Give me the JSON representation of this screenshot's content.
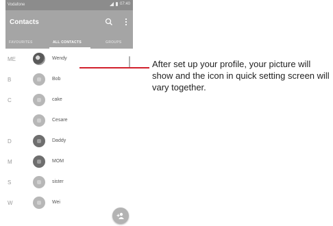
{
  "status_bar": {
    "carrier": "Vodafone",
    "time": "07:40"
  },
  "app_bar": {
    "title": "Contacts",
    "search_icon": "search-icon",
    "more_icon": "more-vert-icon",
    "tabs": [
      {
        "label": "FAVOURITES",
        "active": false
      },
      {
        "label": "ALL CONTACTS",
        "active": true
      },
      {
        "label": "GROUPS",
        "active": false
      }
    ]
  },
  "contacts": [
    {
      "letter": "ME",
      "name": "Wendy",
      "avatar": "photo"
    },
    {
      "letter": "B",
      "name": "Bob",
      "avatar": "light"
    },
    {
      "letter": "C",
      "name": "cake",
      "avatar": "light"
    },
    {
      "letter": "",
      "name": "Cesare",
      "avatar": "light"
    },
    {
      "letter": "D",
      "name": "Daddy",
      "avatar": "dark"
    },
    {
      "letter": "M",
      "name": "MOM",
      "avatar": "dark"
    },
    {
      "letter": "S",
      "name": "sister",
      "avatar": "light"
    },
    {
      "letter": "W",
      "name": "Wei",
      "avatar": "light"
    }
  ],
  "fab": {
    "icon": "add-contact-icon"
  },
  "callout": {
    "text": "After set up your profile, your picture will show and the icon in quick setting screen will vary together.",
    "color": "#d21f2b"
  }
}
